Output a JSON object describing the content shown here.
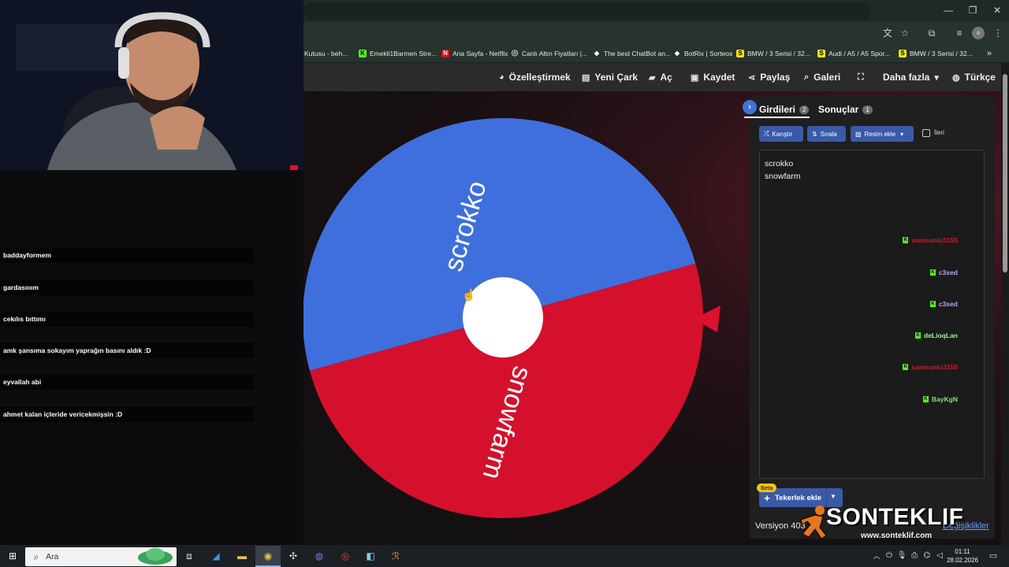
{
  "browser": {
    "bookmarks": [
      {
        "label": "Kutusu - beh...",
        "icon": "mail-icon",
        "color": "#888888"
      },
      {
        "label": "Emekli1Barmen Stre...",
        "icon": "kick-icon",
        "color": "#53fc18"
      },
      {
        "label": "Ana Sayfa - Netflix",
        "icon": "netflix-icon",
        "color": "#e50914"
      },
      {
        "label": "Canlı Altın Fiyatları |...",
        "icon": "globe-icon",
        "color": "#cccccc"
      },
      {
        "label": "The best ChatBot an...",
        "icon": "diamond-icon",
        "color": "#ffffff"
      },
      {
        "label": "BotRix | Sorteos",
        "icon": "diamond-icon",
        "color": "#ffffff"
      },
      {
        "label": "BMW / 3 Serisi / 32...",
        "icon": "s-icon",
        "color": "#f5e50f"
      },
      {
        "label": "Audi / A5 / A5 Spor...",
        "icon": "s-icon",
        "color": "#f5e50f"
      },
      {
        "label": "BMW / 3 Serisi / 32...",
        "icon": "s-icon",
        "color": "#f5e50f"
      }
    ],
    "more_bookmarks": "»"
  },
  "header": {
    "nav": [
      {
        "label": "Özelleştirmek",
        "icon": "palette-icon"
      },
      {
        "label": "Yeni Çark",
        "icon": "file-icon"
      },
      {
        "label": "Aç",
        "icon": "folder-icon"
      },
      {
        "label": "Kaydet",
        "icon": "save-icon"
      },
      {
        "label": "Paylaş",
        "icon": "share-icon"
      },
      {
        "label": "Galeri",
        "icon": "search-icon"
      },
      {
        "label": "",
        "icon": "fullscreen-icon"
      },
      {
        "label": "Daha fazla",
        "icon": "chevron-down-icon"
      },
      {
        "label": "Türkçe",
        "icon": "globe-icon"
      }
    ]
  },
  "wheel": {
    "segments": [
      {
        "label": "scrokko",
        "color": "#3f6fdc"
      },
      {
        "label": "snowfarm",
        "color": "#d4102d"
      }
    ],
    "pointer_color": "#e01030"
  },
  "panel": {
    "tabs": [
      {
        "label": "Girdileri",
        "count": "2"
      },
      {
        "label": "Sonuçlar",
        "count": "1"
      }
    ],
    "buttons": {
      "shuffle": "Karıştır",
      "sort": "Sırala",
      "add_image": "Resim ekle",
      "advanced": "İleri"
    },
    "entries": [
      "scrokko",
      "snowfarm"
    ],
    "beta": "Beta",
    "add_wheel": "Tekerlek ekle",
    "version": "Versiyon 403",
    "changelog": "Değişiklikler"
  },
  "brand": {
    "name": "SONTEKLIF",
    "url": "www.sonteklif.com"
  },
  "chat": [
    {
      "user": "samsunlu3155",
      "color": "#d1182c",
      "message": "baddayformem"
    },
    {
      "user": "c3sed",
      "color": "#b8a4ff",
      "message": "gardasıııım"
    },
    {
      "user": "c3sed",
      "color": "#b8a4ff",
      "message": "cekılıs bıttımı"
    },
    {
      "user": "deLioqLan",
      "color": "#9ef0a0",
      "message": "amk şansıma sokayım yaprağın basını aldık :D"
    },
    {
      "user": "samsunlu3155",
      "color": "#d1182c",
      "message": "eyvallah abi"
    },
    {
      "user": "BayKgN",
      "color": "#7fe07f",
      "message": "ahmet kalan içleride vericekmişsin :D"
    }
  ],
  "taskbar": {
    "search_placeholder": "Ara",
    "time": "01:11",
    "date": "28.02.2026"
  }
}
